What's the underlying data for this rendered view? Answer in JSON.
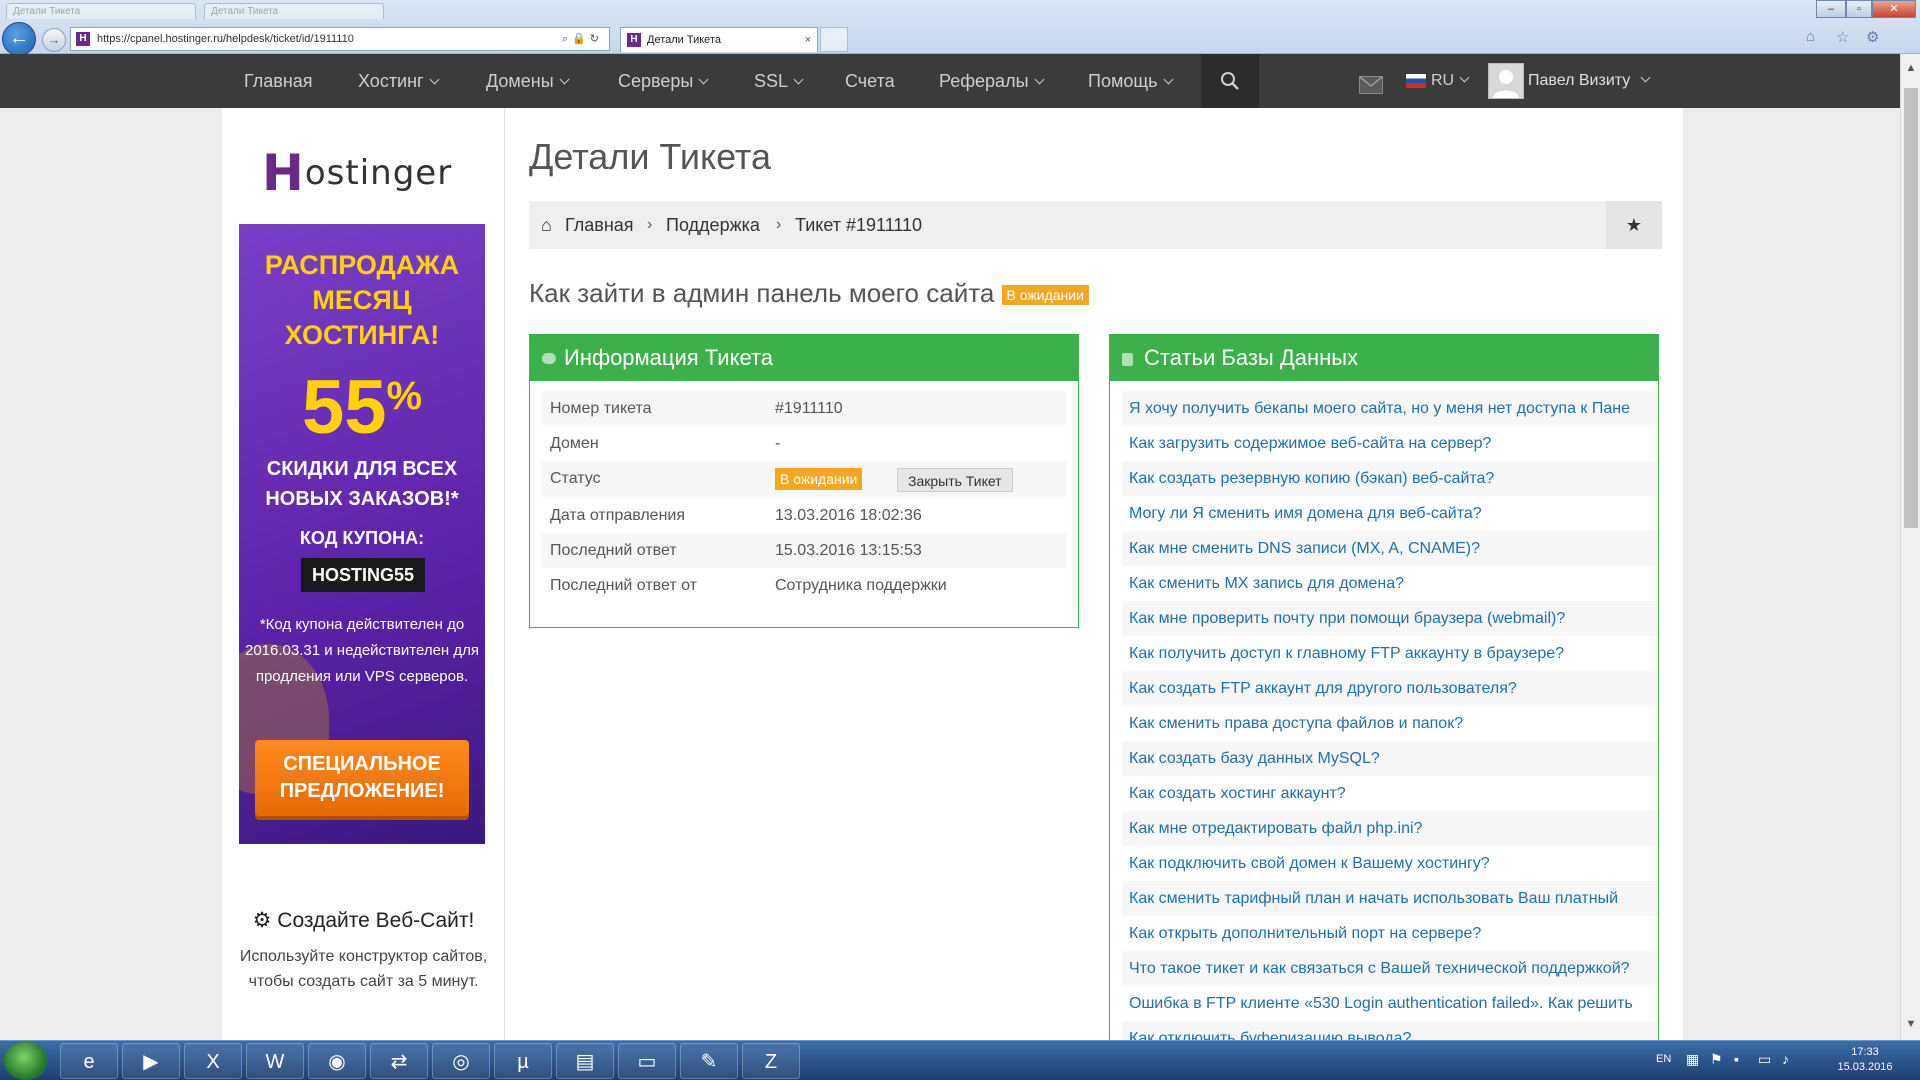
{
  "browser": {
    "url": "https://cpanel.hostinger.ru/helpdesk/ticket/id/1911110",
    "tab_title": "Детали Тикета",
    "tab_close": "×",
    "ghost_tab_1": "Детали Тикета",
    "ghost_tab_2": "Детали Тикета"
  },
  "nav": {
    "items": [
      "Главная",
      "Хостинг",
      "Домены",
      "Серверы",
      "SSL",
      "Счета",
      "Рефералы",
      "Помощь"
    ],
    "lang": "RU",
    "user": "Павел Визиту"
  },
  "sidebar": {
    "banner": {
      "title": "РАСПРОДАЖА МЕСЯЦ ХОСТИНГА!",
      "percent": "55",
      "percent_sign": "%",
      "subtitle": "СКИДКИ ДЛЯ ВСЕХ НОВЫХ ЗАКАЗОВ!*",
      "code_label": "КОД КУПОНА:",
      "code": "HOSTING55",
      "note": "*Код купона действителен до 2016.03.31 и недействителен для продления или VPS серверов.",
      "cta": "СПЕЦИАЛЬНОЕ ПРЕДЛОЖЕНИЕ!"
    },
    "create_title": "Создайте Веб-Сайт!",
    "create_text": "Используйте конструктор сайтов, чтобы создать сайт за 5 минут."
  },
  "main": {
    "page_title": "Детали Тикета",
    "breadcrumb": [
      "Главная",
      "Поддержка",
      "Тикет #1911110"
    ],
    "subject": "Как зайти в админ панель моего сайта",
    "subject_status": "В ожидании",
    "info": {
      "title": "Информация Тикета",
      "rows": [
        {
          "label": "Номер тикета",
          "value": "#1911110"
        },
        {
          "label": "Домен",
          "value": "-"
        },
        {
          "label": "Статус",
          "value": "В ожидании"
        },
        {
          "label": "Дата отправления",
          "value": "13.03.2016 18:02:36"
        },
        {
          "label": "Последний ответ",
          "value": "15.03.2016 13:15:53"
        },
        {
          "label": "Последний ответ от",
          "value": "Сотрудника поддержки"
        }
      ],
      "close_button": "Закрыть Тикет"
    },
    "kb": {
      "title": "Статьи Базы Данных",
      "items": [
        "Я хочу получить бекапы моего сайта, но у меня нет доступа к Пане",
        "Как загрузить содержимое веб-сайта на сервер?",
        "Как создать резервную копию (бэкап) веб-сайта?",
        "Могу ли Я сменить имя домена для веб-сайта?",
        "Как мне сменить DNS записи (MX, A, CNAME)?",
        "Как сменить MX запись для домена?",
        "Как мне проверить почту при помощи браузера (webmail)?",
        "Как получить доступ к главному FTP аккаунту в браузере?",
        "Как создать FTP аккаунт для другого пользователя?",
        "Как сменить права доступа файлов и папок?",
        "Как создать базу данных MySQL?",
        "Как создать хостинг аккаунт?",
        "Как мне отредактировать файл php.ini?",
        "Как подключить свой домен к Вашему хостингу?",
        "Как сменить тарифный план и начать использовать Ваш платный",
        "Как открыть дополнительный порт на сервере?",
        "Что такое тикет и как связаться с Вашей технической поддержкой?",
        "Ошибка в FTP клиенте «530 Login authentication failed». Как решить",
        "Как отключить буферизацию вывода?"
      ]
    }
  },
  "taskbar": {
    "lang": "EN",
    "time": "17:33",
    "date": "15.03.2016"
  },
  "colors": {
    "nav_bg": "#3b3b3b",
    "panel_green": "#3cb04a",
    "badge_orange": "#f5a623",
    "link_blue": "#1f6fa8",
    "brand_purple": "#6a2a8c"
  }
}
